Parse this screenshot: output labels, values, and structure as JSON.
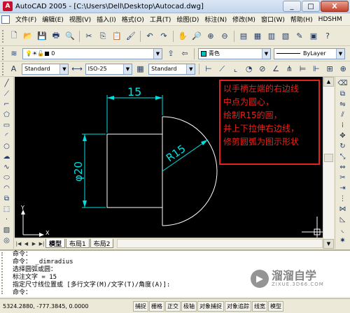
{
  "window": {
    "app_icon": "A",
    "title": "AutoCAD 2005 - [C:\\Users\\Dell\\Desktop\\Autocad.dwg]",
    "minimize": "_",
    "maximize": "□",
    "close": "X"
  },
  "menu": {
    "items": [
      "文件(F)",
      "编辑(E)",
      "视图(V)",
      "插入(I)",
      "格式(O)",
      "工具(T)",
      "绘图(D)",
      "标注(N)",
      "修改(M)",
      "窗口(W)",
      "帮助(H)",
      "HDSHM"
    ],
    "doc_min": "_",
    "doc_restore": "□",
    "doc_close": "x"
  },
  "toolbar": {
    "color_combo": "青色",
    "linetype_combo": "ByLayer",
    "layer_value": "0",
    "text_style_combo": "Standard",
    "dim_style_combo": "ISO-25",
    "table_style_combo": "Standard"
  },
  "drawing": {
    "dim_horizontal": "15",
    "dim_diameter": "φ20",
    "dim_radius": "R15",
    "ucs_x": "X",
    "ucs_y": "Y"
  },
  "annotation": {
    "lines": [
      "以手柄左端的右边线",
      "中点为圆心，",
      "绘制R15的圆，",
      "并上下拉伸右边线，",
      "修剪圆弧为图示形状"
    ],
    "color": "#e6231a"
  },
  "layout_tabs": [
    "模型",
    "布局1",
    "布局2"
  ],
  "command_history": [
    "命令：",
    "命令： _dimradius",
    "选择圆弧或圆：",
    "标注文字 = 15",
    "指定尺寸线位置或 [多行文字(M)/文字(T)/角度(A)]:",
    "命令：",
    "命令："
  ],
  "status": {
    "coordinates": "5324.2880,  -777.3845, 0.0000",
    "toggles": [
      "捕捉",
      "栅格",
      "正交",
      "极轴",
      "对象捕捉",
      "对象追踪",
      "线宽",
      "模型"
    ]
  },
  "watermark": {
    "text": "溜溜自学",
    "sub": "ZIXUE.3D66.COM",
    "logo_glyph": "▶"
  },
  "colors": {
    "canvas": "#000000",
    "geometry": "#ffffff",
    "dimension": "#00e0e0"
  }
}
